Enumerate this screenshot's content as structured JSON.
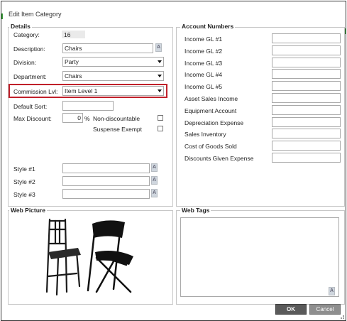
{
  "window": {
    "title": "Edit Item Category"
  },
  "details": {
    "legend": "Details",
    "category_label": "Category:",
    "category_value": "16",
    "description_label": "Description:",
    "description_value": "Chairs",
    "division_label": "Division:",
    "division_value": "Party",
    "department_label": "Department:",
    "department_value": "Chairs",
    "commission_label": "Commission Lvl:",
    "commission_value": "Item Level 1",
    "default_sort_label": "Default Sort:",
    "default_sort_value": "",
    "max_discount_label": "Max Discount:",
    "max_discount_value": "0",
    "max_discount_unit": "%",
    "non_discountable_label": "Non-discountable",
    "suspense_exempt_label": "Suspense Exempt",
    "style1_label": "Style #1",
    "style2_label": "Style #2",
    "style3_label": "Style #3",
    "translate_icon_glyph": "A"
  },
  "accounts": {
    "legend": "Account Numbers",
    "labels": [
      "Income GL #1",
      "Income GL #2",
      "Income GL #3",
      "Income GL #4",
      "Income GL #5",
      "Asset Sales Income",
      "Equipment Account",
      "Depreciation Expense",
      "Sales Inventory",
      "Cost of Goods Sold",
      "Discounts Given Expense"
    ]
  },
  "web_picture": {
    "legend": "Web Picture"
  },
  "web_tags": {
    "legend": "Web Tags",
    "value": ""
  },
  "buttons": {
    "ok": "OK",
    "cancel": "Cancel"
  },
  "colors": {
    "highlight": "#c0202a",
    "accent": "#3a9a3a",
    "ok_bg": "#5a5a5a",
    "cancel_bg": "#8e8e8e"
  }
}
